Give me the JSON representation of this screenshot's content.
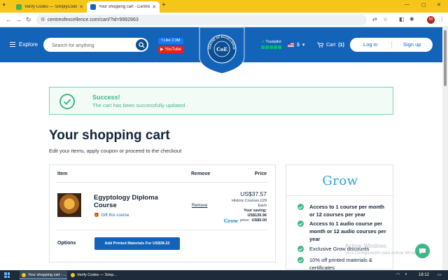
{
  "browser": {
    "tabs": [
      {
        "title": "Verify Codes — SimplyCodes",
        "active": false
      },
      {
        "title": "Your shopping cart - Centre of E",
        "active": true
      }
    ],
    "url": "centreofexcellence.com/cart/?id=9992663"
  },
  "header": {
    "explore": "Explore",
    "search_placeholder": "Search for anything",
    "facebook": "Like 2.3M",
    "youtube": "YouTube",
    "crest_top": "CENTRE OF EXCELLENCE",
    "crest_mono": "CoE",
    "trustpilot": "Trustpilot",
    "currency": "$",
    "cart_label": "Cart",
    "cart_count": "(1)",
    "login": "Log in",
    "signup": "Sign up"
  },
  "success": {
    "title": "Success!",
    "message": "The cart has been successfully updated"
  },
  "page": {
    "title": "Your shopping cart",
    "subtitle": "Edit your items, apply coupon or proceed to the checkout"
  },
  "cart": {
    "columns": {
      "item": "Item",
      "remove": "Remove",
      "price": "Price"
    },
    "item": {
      "title": "Egyptology Diploma Course",
      "gift": "Gift this course",
      "remove": "Remove",
      "price": "US$37.57",
      "original_line1": "History Courses £29",
      "original_line2": "Each",
      "saving_label": "Your saving:",
      "saving_value": "US$126.96",
      "grow_label": "Grow",
      "grow_price_label": "price:",
      "grow_price_value": "US$0.00"
    },
    "options_label": "Options",
    "options_button": "Add Printed Materials For US$38.22"
  },
  "grow": {
    "logo": "Grow",
    "benefits": [
      {
        "text": "Access to 1 course per month or 12 courses per year",
        "bold": true
      },
      {
        "text": "Access to 1 audio course per month or 12 audio courses per year",
        "bold": true
      },
      {
        "text": "Exclusive Grow discounts",
        "bold": false
      },
      {
        "text": "10% off printed materials & certificates",
        "bold": false
      }
    ]
  },
  "watermark": {
    "line1": "Activar Windows",
    "line2": "Ve a Configuración para activar Windows."
  },
  "taskbar": {
    "items": [
      "Your shopping cart - ...",
      "Verify Codes — Simp..."
    ],
    "time": "18:12"
  },
  "colors": {
    "brand_blue": "#1364b8",
    "success_green": "#3fb889",
    "grow_teal": "#2aa4d5",
    "browser_tabbar": "#f5c518"
  },
  "icons": {
    "explore": "hamburger-icon",
    "search": "search-icon",
    "cart": "cart-icon",
    "success": "check-circle-icon",
    "gift": "gift-icon",
    "benefit": "check-icon",
    "chat": "chat-icon"
  }
}
